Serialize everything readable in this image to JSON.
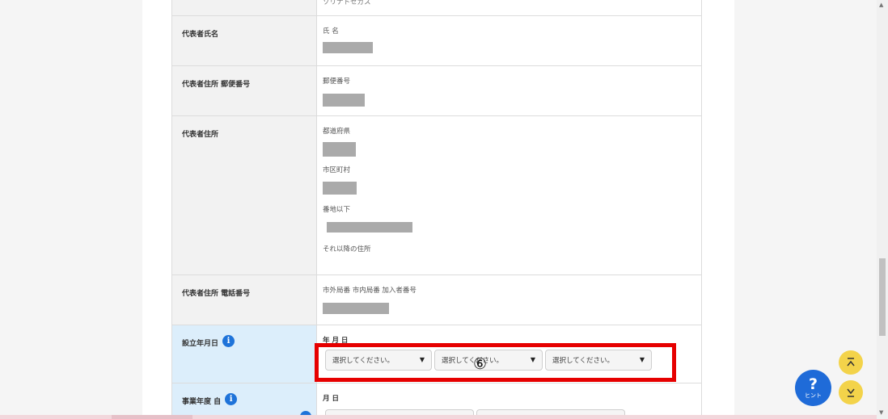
{
  "rows": {
    "top_partial": {
      "value_text": "ソリナトセガス"
    },
    "rep_name": {
      "label": "代表者氏名",
      "field": "氏 名"
    },
    "rep_postal": {
      "label": "代表者住所 郵便番号",
      "field": "郵便番号"
    },
    "rep_address": {
      "label": "代表者住所",
      "prefecture": "都道府県",
      "city": "市区町村",
      "street": "番地以下",
      "other": "それ以降の住所"
    },
    "rep_phone": {
      "label": "代表者住所 電話番号",
      "field": "市外局番 市内局番 加入者番号"
    },
    "founded": {
      "label": "設立年月日",
      "field": "年 月 日",
      "select_year": "選択してください。",
      "select_month": "選択してください。",
      "select_day": "選択してください。"
    },
    "fiscal_start": {
      "label": "事業年度 自",
      "field": "月 日"
    }
  },
  "annotation": {
    "number": "⑥"
  },
  "icons": {
    "info": "info-icon",
    "arrow_up": "double-chevron-up-icon",
    "arrow_down": "double-chevron-down-icon",
    "hint": "question-icon"
  },
  "hint_button": {
    "symbol": "?",
    "label": "ヒント"
  },
  "colors": {
    "accent_blue": "#1e73d9",
    "highlight_row": "#dceefb",
    "annotation_red": "#e60000",
    "fab_yellow": "#f3d34a"
  }
}
